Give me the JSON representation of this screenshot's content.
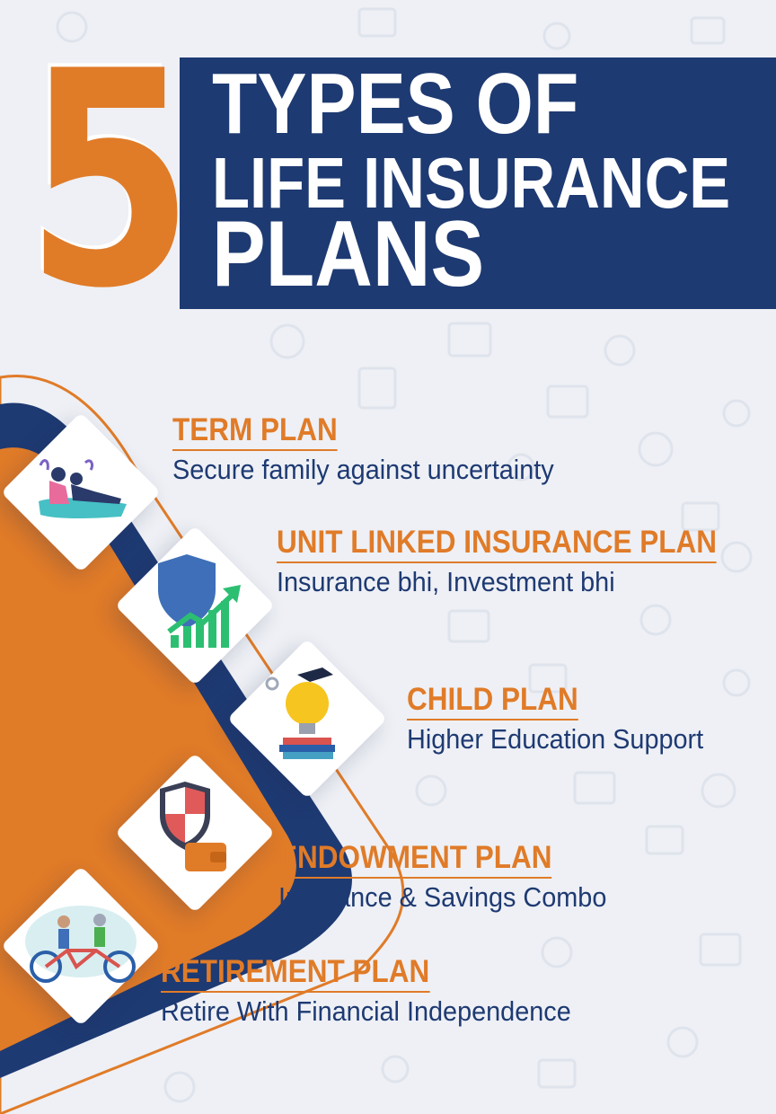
{
  "header": {
    "number": "5",
    "line1": "TYPES OF",
    "line2": "LIFE INSURANCE",
    "line3": "PLANS"
  },
  "colors": {
    "accent": "#e07b28",
    "navy": "#1e3a72",
    "background": "#eef0f5"
  },
  "plans": [
    {
      "title": "TERM PLAN",
      "desc": "Secure family against uncertainty",
      "icon": "family-relaxing-icon"
    },
    {
      "title": "UNIT LINKED INSURANCE PLAN",
      "desc": "Insurance bhi, Investment bhi",
      "icon": "shield-growth-chart-icon"
    },
    {
      "title": "CHILD PLAN",
      "desc": "Higher Education Support",
      "icon": "lightbulb-graduation-icon"
    },
    {
      "title": "ENDOWMENT PLAN",
      "desc": "Insurance & Savings Combo",
      "icon": "shield-wallet-icon"
    },
    {
      "title": "RETIREMENT PLAN",
      "desc": "Retire With Financial Independence",
      "icon": "tandem-bicycle-icon"
    }
  ]
}
